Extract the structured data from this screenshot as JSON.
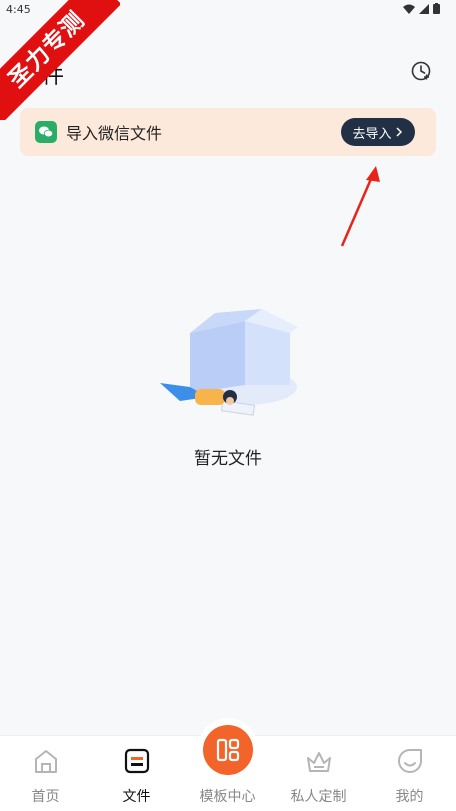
{
  "status_bar": {
    "time": "4:45"
  },
  "watermark": "圣力专测",
  "header": {
    "title": "文件"
  },
  "banner": {
    "text": "导入微信文件",
    "button": "去导入"
  },
  "empty_state": {
    "text": "暂无文件"
  },
  "tabs": [
    {
      "label": "首页"
    },
    {
      "label": "文件"
    },
    {
      "label": "模板中心"
    },
    {
      "label": "私人定制"
    },
    {
      "label": "我的"
    }
  ],
  "colors": {
    "accent": "#f2642a",
    "banner_bg": "#fde8dc",
    "button_dark": "#223046",
    "wechat_green": "#2aae67"
  }
}
